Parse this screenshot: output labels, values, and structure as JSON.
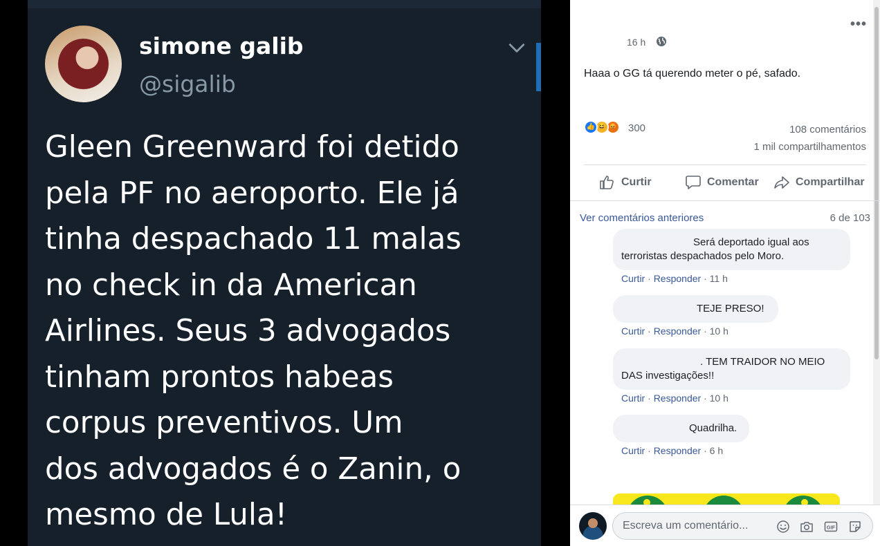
{
  "tweet": {
    "name": "simone galib",
    "handle": "@sigalib",
    "lines": [
      "Gleen Greenward foi detido",
      "pela PF no aeroporto. Ele já",
      "tinha despachado 11 malas",
      "no check in da American",
      "Airlines. Seus 3 advogados",
      "tinham prontos habeas",
      "corpus preventivos. Um",
      "dos advogados é o Zanin, o",
      "mesmo de Lula!"
    ]
  },
  "post": {
    "more": "•••",
    "time": "16 h",
    "text": "Haaa o GG tá querendo meter o pé, safado.",
    "reaction_count": "300",
    "comments_count": "108 comentários",
    "shares_count": "1 mil compartilhamentos",
    "reaction_icons": [
      "like-icon",
      "haha-icon",
      "angry-icon"
    ],
    "actions": {
      "like": "Curtir",
      "comment": "Comentar",
      "share": "Compartilhar"
    }
  },
  "comments": {
    "view_previous": "Ver comentários anteriores",
    "counter": "6 de 103",
    "items": [
      {
        "line1": "Será deportado igual aos",
        "line2": "terroristas despachados pelo Moro.",
        "like": "Curtir",
        "reply": "Responder",
        "ago": "11 h"
      },
      {
        "line1": "TEJE PRESO!",
        "like": "Curtir",
        "reply": "Responder",
        "ago": "10 h"
      },
      {
        "line1": ". TEM TRAIDOR NO MEIO",
        "line2": "DAS investigações!!",
        "like": "Curtir",
        "reply": "Responder",
        "ago": "10 h"
      },
      {
        "line1": "Quadrilha.",
        "like": "Curtir",
        "reply": "Responder",
        "ago": "6 h"
      }
    ]
  },
  "composer": {
    "placeholder": "Escreva um comentário...",
    "icons": [
      "emoji-icon",
      "camera-icon",
      "gif-icon",
      "sticker-icon"
    ]
  },
  "colors": {
    "tweet_bg": "#15202b",
    "fb_link": "#385898",
    "like_blue": "#1877f2"
  }
}
